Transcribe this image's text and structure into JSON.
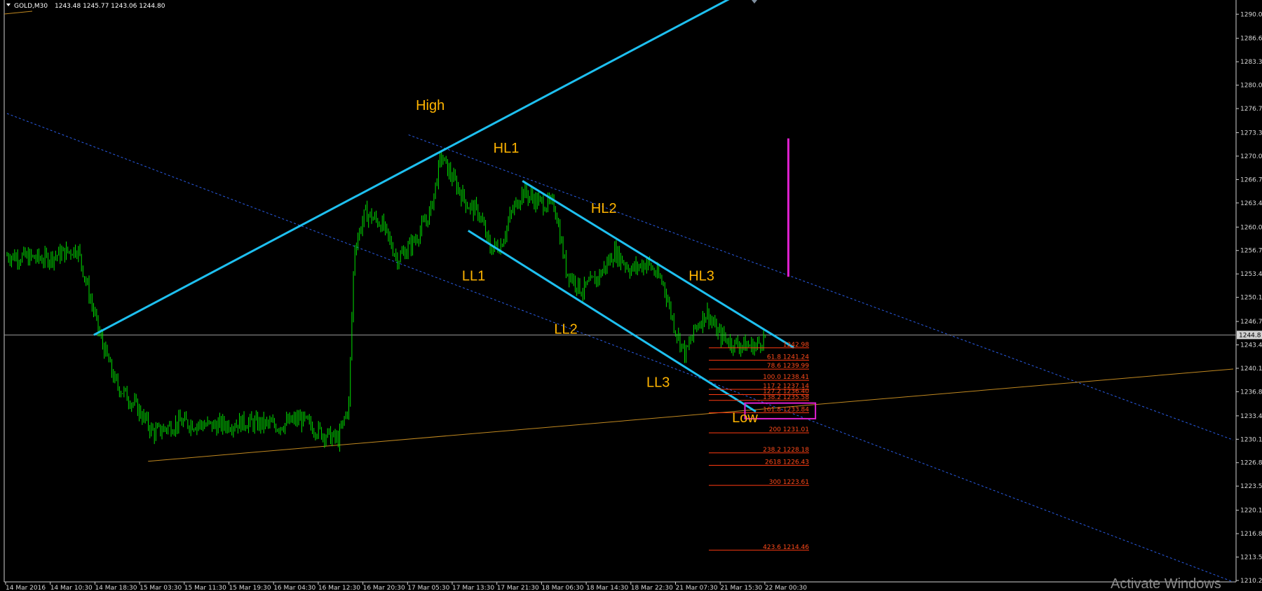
{
  "header": {
    "symbol_label": "GOLD,M30",
    "ohlc_label": "1243.48 1245.77 1243.06 1244.80",
    "dropdown_icon": "triangle-down-icon"
  },
  "watermark": "Activate Windows",
  "current_price_label": "1244.8",
  "colors": {
    "background": "#000000",
    "candle": "#00e000",
    "trendline": "#1ec0f0",
    "dashed_channel": "#2a5de8",
    "support_line": "#c08820",
    "fib_lines": "#ff3a10",
    "wave_labels": "#ffb400",
    "magenta_marker": "#e020d0",
    "price_line": "#9a9a9a"
  },
  "chart_data": {
    "type": "candlestick",
    "title": "",
    "xlabel": "",
    "ylabel": "",
    "ylim": [
      1210.0,
      1292.0
    ],
    "y_tick_labels": [
      "1290.0",
      "1286.6",
      "1283.3",
      "1280.0",
      "1276.7",
      "1273.3",
      "1270.0",
      "1266.7",
      "1263.4",
      "1260.0",
      "1256.7",
      "1253.4",
      "1250.1",
      "1246.7",
      "1243.4",
      "1240.1",
      "1236.8",
      "1233.4",
      "1230.1",
      "1226.8",
      "1223.5",
      "1220.1",
      "1216.8",
      "1213.5",
      "1210.2"
    ],
    "x_tick_labels": [
      "14 Mar 2016",
      "14 Mar 10:30",
      "14 Mar 18:30",
      "15 Mar 03:30",
      "15 Mar 11:30",
      "15 Mar 19:30",
      "16 Mar 04:30",
      "16 Mar 12:30",
      "16 Mar 20:30",
      "17 Mar 05:30",
      "17 Mar 13:30",
      "17 Mar 21:30",
      "18 Mar 06:30",
      "18 Mar 14:30",
      "18 Mar 22:30",
      "21 Mar 07:30",
      "21 Mar 15:30",
      "22 Mar 00:30"
    ],
    "price_path": [
      {
        "x": 0,
        "y": 1256.0
      },
      {
        "x": 7,
        "y": 1255.5
      },
      {
        "x": 13,
        "y": 1257.0
      },
      {
        "x": 17,
        "y": 1245.0
      },
      {
        "x": 20,
        "y": 1238.0
      },
      {
        "x": 24,
        "y": 1234.5
      },
      {
        "x": 27,
        "y": 1231.0
      },
      {
        "x": 32,
        "y": 1232.5
      },
      {
        "x": 38,
        "y": 1232.0
      },
      {
        "x": 44,
        "y": 1232.5
      },
      {
        "x": 50,
        "y": 1232.0
      },
      {
        "x": 54,
        "y": 1233.0
      },
      {
        "x": 58,
        "y": 1231.0
      },
      {
        "x": 61,
        "y": 1230.0
      },
      {
        "x": 63,
        "y": 1235.0
      },
      {
        "x": 64,
        "y": 1257.0
      },
      {
        "x": 66,
        "y": 1262.0
      },
      {
        "x": 69,
        "y": 1260.5
      },
      {
        "x": 72,
        "y": 1255.5
      },
      {
        "x": 75,
        "y": 1258.0
      },
      {
        "x": 78,
        "y": 1262.0
      },
      {
        "x": 80,
        "y": 1270.0
      },
      {
        "x": 82,
        "y": 1267.0
      },
      {
        "x": 85,
        "y": 1263.0
      },
      {
        "x": 87,
        "y": 1262.0
      },
      {
        "x": 89,
        "y": 1257.0
      },
      {
        "x": 91,
        "y": 1257.5
      },
      {
        "x": 93,
        "y": 1262.0
      },
      {
        "x": 95,
        "y": 1265.0
      },
      {
        "x": 98,
        "y": 1263.5
      },
      {
        "x": 101,
        "y": 1263.0
      },
      {
        "x": 103,
        "y": 1254.0
      },
      {
        "x": 106,
        "y": 1251.0
      },
      {
        "x": 109,
        "y": 1253.0
      },
      {
        "x": 112,
        "y": 1256.5
      },
      {
        "x": 115,
        "y": 1254.0
      },
      {
        "x": 118,
        "y": 1255.0
      },
      {
        "x": 121,
        "y": 1252.0
      },
      {
        "x": 123,
        "y": 1246.0
      },
      {
        "x": 125,
        "y": 1242.0
      },
      {
        "x": 127,
        "y": 1246.0
      },
      {
        "x": 129,
        "y": 1248.0
      },
      {
        "x": 131,
        "y": 1245.0
      },
      {
        "x": 134,
        "y": 1243.5
      },
      {
        "x": 138,
        "y": 1243.2
      },
      {
        "x": 140,
        "y": 1244.8
      }
    ],
    "trendlines": [
      {
        "name": "upper trendline",
        "x1": 16,
        "y1": 1244.8,
        "x2": 134,
        "y2": 1292.5
      },
      {
        "name": "channel top",
        "x1": 95,
        "y1": 1266.5,
        "x2": 145,
        "y2": 1243.0
      },
      {
        "name": "channel bottom",
        "x1": 85,
        "y1": 1259.5,
        "x2": 138,
        "y2": 1234.0
      }
    ],
    "dashed_lines": [
      {
        "x1": 0,
        "y1": 1276.0,
        "x2": 226,
        "y2": 1210.0
      },
      {
        "x1": 74,
        "y1": 1273.0,
        "x2": 226,
        "y2": 1230.0
      }
    ],
    "support_line": {
      "x1": 26,
      "y1": 1227.0,
      "x2": 226,
      "y2": 1240.0
    },
    "current_price": 1244.8,
    "wave_labels": [
      {
        "text": "High",
        "x": 78,
        "y": 1276.5
      },
      {
        "text": "HL1",
        "x": 92,
        "y": 1270.5
      },
      {
        "text": "HL2",
        "x": 110,
        "y": 1262.0
      },
      {
        "text": "HL3",
        "x": 128,
        "y": 1252.5
      },
      {
        "text": "LL1",
        "x": 86,
        "y": 1252.5
      },
      {
        "text": "LL2",
        "x": 103,
        "y": 1245.0
      },
      {
        "text": "LL3",
        "x": 120,
        "y": 1237.5
      },
      {
        "text": "Low",
        "x": 136,
        "y": 1232.5
      }
    ],
    "fibonacci_levels": [
      {
        "level": "",
        "value": 1242.98,
        "label": "1242.98"
      },
      {
        "level": "61.8",
        "value": 1241.24,
        "label": "61.8 1241.24"
      },
      {
        "level": "78.6",
        "value": 1239.99,
        "label": "78.6 1239.99"
      },
      {
        "level": "100.0",
        "value": 1238.41,
        "label": "100.0 1238.41"
      },
      {
        "level": "117.2",
        "value": 1237.14,
        "label": "117.2 1237.14"
      },
      {
        "level": "127.2",
        "value": 1236.4,
        "label": "127.2 1236.40"
      },
      {
        "level": "138.2",
        "value": 1235.58,
        "label": "138.2 1235.58"
      },
      {
        "level": "161.8",
        "value": 1233.84,
        "label": "161.8 1233.84"
      },
      {
        "level": "200",
        "value": 1231.01,
        "label": "200 1231.01"
      },
      {
        "level": "238.2",
        "value": 1228.18,
        "label": "238.2 1228.18"
      },
      {
        "level": "2618",
        "value": 1226.43,
        "label": "2618 1226.43"
      },
      {
        "level": "300",
        "value": 1223.61,
        "label": "300 1223.61"
      },
      {
        "level": "423.6",
        "value": 1214.46,
        "label": "423.6 1214.46"
      }
    ],
    "target_box": {
      "x1": 136,
      "y1": 1235.2,
      "x2": 149,
      "y2": 1233.0
    },
    "magenta_marker": {
      "x": 144,
      "y1": 1272.5,
      "y2": 1253.0
    },
    "x_range": [
      0,
      226
    ]
  }
}
